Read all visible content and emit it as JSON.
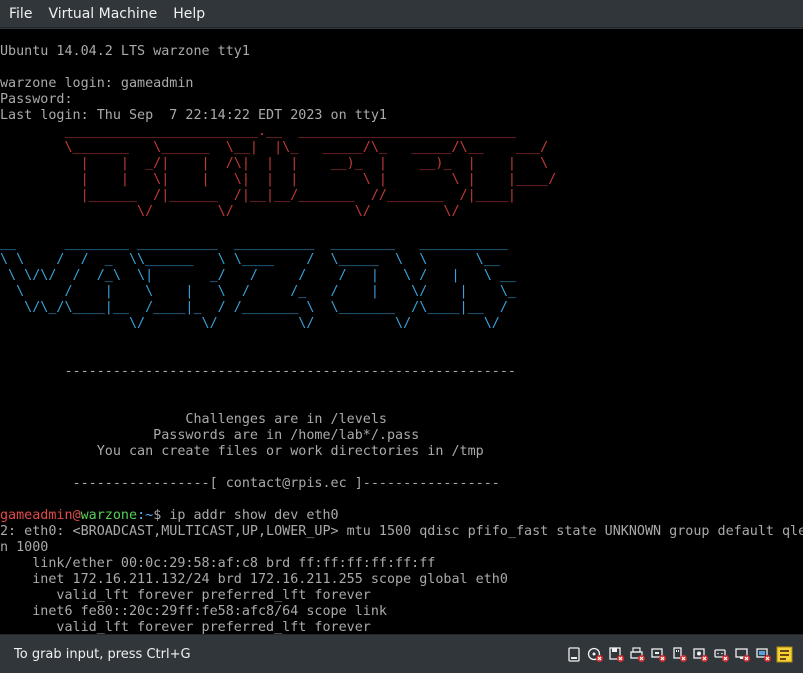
{
  "menubar": {
    "items": [
      "File",
      "Virtual Machine",
      "Help"
    ]
  },
  "console": {
    "banner": "Ubuntu 14.04.2 LTS warzone tty1",
    "login_line": "warzone login: gameadmin",
    "password_line": "Password:",
    "last_login": "Last login: Thu Sep  7 22:14:22 EDT 2023 on tty1",
    "art_red": [
      "        ________________________.__  ___________________________",
      "        \\_______   \\______  \\__|  |\\_   _____/\\_   _____/\\__    ___/",
      "          |    |  _/|    |  /\\|  |  |    __)_  |    __)_  |    |   \\",
      "          |    |   \\|    |   \\|  |  |        \\ |        \\ |    |____/",
      "          |______  /|______  /|__|__/_______  //_______  /|____|",
      "                 \\/        \\/               \\/         \\/"
    ],
    "art_blue": [
      "__      ________ __________  __________  ________   ___________",
      "\\ \\    /  /  _  \\\\______   \\ \\____    /  \\_____  \\  \\      \\__",
      " \\ \\/\\/  /  /_\\  \\|       _/   /     /    /   |   \\ /   |   \\ __",
      "  \\     /    |    \\    |   \\  /     /_   /    |    \\/    |    \\_",
      "   \\/\\_/\\____|__  /____|_  / /_______ \\  \\_______  /\\____|__  /",
      "                \\/       \\/          \\/          \\/         \\/"
    ],
    "divider": "        --------------------------------------------------------",
    "info": [
      "                       Challenges are in /levels",
      "                   Passwords are in /home/lab*/.pass",
      "            You can create files or work directories in /tmp"
    ],
    "contact": "         -----------------[ contact@rpis.ec ]-----------------",
    "prompt_user": "gameadmin",
    "prompt_at": "@",
    "prompt_host": "warzone",
    "prompt_colon": ":",
    "prompt_path": "~",
    "prompt_dollar": "$ ",
    "command": "ip addr show dev eth0",
    "output": [
      "2: eth0: <BROADCAST,MULTICAST,UP,LOWER_UP> mtu 1500 qdisc pfifo_fast state UNKNOWN group default qle",
      "n 1000",
      "    link/ether 00:0c:29:58:af:c8 brd ff:ff:ff:ff:ff:ff",
      "    inet 172.16.211.132/24 brd 172.16.211.255 scope global eth0",
      "       valid_lft forever preferred_lft forever",
      "    inet6 fe80::20c:29ff:fe58:afc8/64 scope link",
      "       valid_lft forever preferred_lft forever"
    ],
    "cursor": "_"
  },
  "statusbar": {
    "text": "To grab input, press Ctrl+G",
    "indicators": [
      "hard-disk-icon",
      "cd-disabled-icon",
      "floppy-disabled-icon",
      "printer-disabled-icon",
      "network-disabled-icon",
      "usb-disabled-icon",
      "sound-disabled-icon",
      "serial-disabled-icon",
      "display-disabled-icon",
      "usb2-disabled-icon",
      "message-icon"
    ]
  }
}
